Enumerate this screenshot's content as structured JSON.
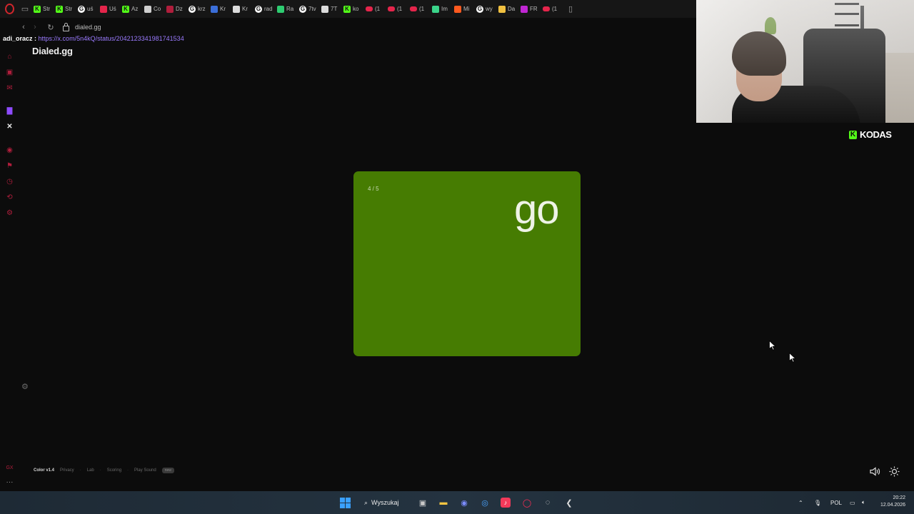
{
  "browser": {
    "tabs": [
      {
        "label": "Str",
        "icon": "kick-icon",
        "color": "#53fc18"
      },
      {
        "label": "Str",
        "icon": "kick-icon",
        "color": "#53fc18"
      },
      {
        "label": "uś",
        "icon": "google-icon",
        "color": "#ffffff"
      },
      {
        "label": "Uś",
        "icon": "bolt-icon",
        "color": "#e5254b"
      },
      {
        "label": "Az",
        "icon": "kick-icon",
        "color": "#53fc18"
      },
      {
        "label": "Co",
        "icon": "globe-icon",
        "color": "#cfcfcf"
      },
      {
        "label": "Dz",
        "icon": "globe-icon",
        "color": "#b01e3c"
      },
      {
        "label": "krz",
        "icon": "google-icon",
        "color": "#ffffff"
      },
      {
        "label": "Kr",
        "icon": "note-icon",
        "color": "#3b6ed8"
      },
      {
        "label": "Kr",
        "icon": "tag-icon",
        "color": "#dcdcdc"
      },
      {
        "label": "rad",
        "icon": "google-icon",
        "color": "#ffffff"
      },
      {
        "label": "Ra",
        "icon": "dot-icon",
        "color": "#2ecc71"
      },
      {
        "label": "7tv",
        "icon": "google-icon",
        "color": "#ffffff"
      },
      {
        "label": "7T",
        "icon": "seven-icon",
        "color": "#dcdcdc"
      },
      {
        "label": "ko",
        "icon": "kick-icon",
        "color": "#53fc18"
      },
      {
        "label": "(1",
        "icon": "youtube-icon",
        "color": "#e5254b"
      },
      {
        "label": "(1",
        "icon": "youtube-icon",
        "color": "#e5254b"
      },
      {
        "label": "(1",
        "icon": "youtube-icon",
        "color": "#e5254b"
      },
      {
        "label": "Im",
        "icon": "image-icon",
        "color": "#3bd48a"
      },
      {
        "label": "Mi",
        "icon": "fire-icon",
        "color": "#ff5a1f"
      },
      {
        "label": "wy",
        "icon": "google-icon",
        "color": "#ffffff"
      },
      {
        "label": "Da",
        "icon": "shield-icon",
        "color": "#f0c040"
      },
      {
        "label": "FR",
        "icon": "badge-icon",
        "color": "#c026d3"
      },
      {
        "label": "(1",
        "icon": "youtube-icon",
        "color": "#e5254b"
      }
    ],
    "address": "dialed.gg"
  },
  "chat": {
    "user": "adi_oracz :",
    "link": "https://x.com/5n4kQ/status/2042123341981741534"
  },
  "page": {
    "title": "Dialed.gg",
    "card": {
      "counter": "4 / 5",
      "word": "go",
      "color": "#467c02"
    },
    "footer": {
      "version": "Color v1.4",
      "links": [
        "Privacy",
        "Lab",
        "Scoring",
        "Play Sound"
      ],
      "badge": "new"
    }
  },
  "stream": {
    "brand": "KODAS",
    "brand_color": "#53fc18"
  },
  "taskbar": {
    "search_label": "Wyszukaj",
    "language": "POL",
    "time": "20:22",
    "date": "12.04.2026"
  }
}
